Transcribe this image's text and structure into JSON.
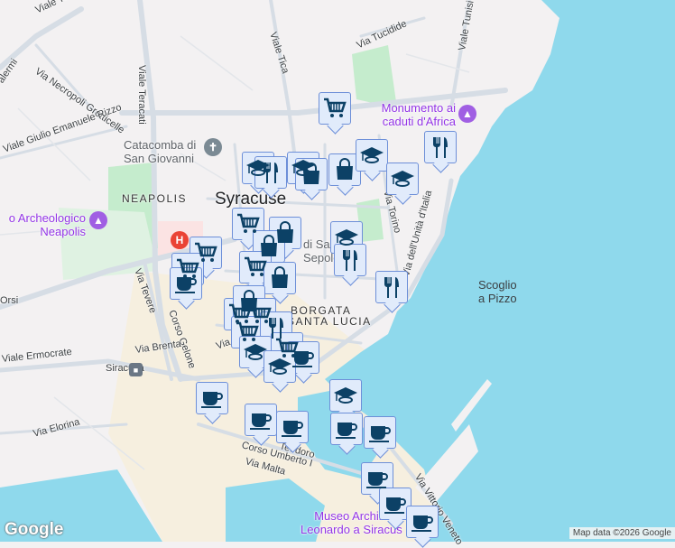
{
  "map": {
    "colors": {
      "land": "#f3f1f2",
      "water": "#8fd9ec",
      "park": "#c5eccd",
      "road": "#d6dde5",
      "marker_bg": "#e1ebfb",
      "marker_border": "#6d8fd8",
      "icon": "#0c4166"
    }
  },
  "labels": {
    "viale_teracati": "Viale Teracati",
    "necropoli": "Via Necropoli Grotticelle",
    "rizzo": "Viale Giulio Emanuele Rizzo",
    "tica": "Viale Tica",
    "tucidide": "Via Tucidide",
    "tunisi": "Viale Tunisi",
    "palermi": "alermi",
    "viale_te": "Viale Te",
    "orsi": "Orsi",
    "torino": "Via Torino",
    "unita": "Via dell'Unità d'Italia",
    "tevere": "Via Tevere",
    "gelone": "Corso Gelone",
    "brenta": "Via Brenta",
    "ermocrate": "Viale Ermocrate",
    "elorina": "Via Elorina",
    "umberto": "Corso Umberto I",
    "malta": "Via Malta",
    "veneto": "Via Vittorio Veneto",
    "teodoro": "Teodoro",
    "via_short": "Via"
  },
  "places": {
    "city": "Syracuse",
    "neapolis": "NEAPOLIS",
    "borgata_1": "BORGATA",
    "borgata_2": "SANTA LUCIA",
    "catacomba_1": "Catacomba di",
    "catacomba_2": "San Giovanni",
    "parco_1": "o Archeologico",
    "parco_2": "Neapolis",
    "monumento_1": "Monumento ai",
    "monumento_2": "caduti d'Africa",
    "sepolcro_1": "di San",
    "sepolcro_2": "Sepolc",
    "scoglio_1": "Scoglio",
    "scoglio_2": "a Pizzo",
    "station": "Siracusa",
    "museo_1": "Museo Archim",
    "museo_2": "Leonardo a Siracus"
  },
  "markers": [
    {
      "type": "cart"
    },
    {
      "type": "grad"
    },
    {
      "type": "fork"
    },
    {
      "type": "grad"
    },
    {
      "type": "bag"
    },
    {
      "type": "bag"
    },
    {
      "type": "grad"
    },
    {
      "type": "grad"
    },
    {
      "type": "fork"
    },
    {
      "type": "cart"
    },
    {
      "type": "bag"
    },
    {
      "type": "grad"
    },
    {
      "type": "fork"
    },
    {
      "type": "fork"
    },
    {
      "type": "cart"
    },
    {
      "type": "cart"
    },
    {
      "type": "coffee"
    },
    {
      "type": "bag"
    },
    {
      "type": "cart"
    },
    {
      "type": "bag"
    },
    {
      "type": "cart"
    },
    {
      "type": "bag"
    },
    {
      "type": "cart"
    },
    {
      "type": "cart"
    },
    {
      "type": "fork"
    },
    {
      "type": "grad"
    },
    {
      "type": "cart"
    },
    {
      "type": "coffee"
    },
    {
      "type": "grad"
    },
    {
      "type": "coffee"
    },
    {
      "type": "coffee"
    },
    {
      "type": "coffee"
    },
    {
      "type": "grad"
    },
    {
      "type": "coffee"
    },
    {
      "type": "coffee"
    },
    {
      "type": "coffee"
    },
    {
      "type": "coffee"
    },
    {
      "type": "coffee"
    }
  ],
  "footer": {
    "logo": "Google",
    "attribution": "Map data ©2026 Google"
  }
}
